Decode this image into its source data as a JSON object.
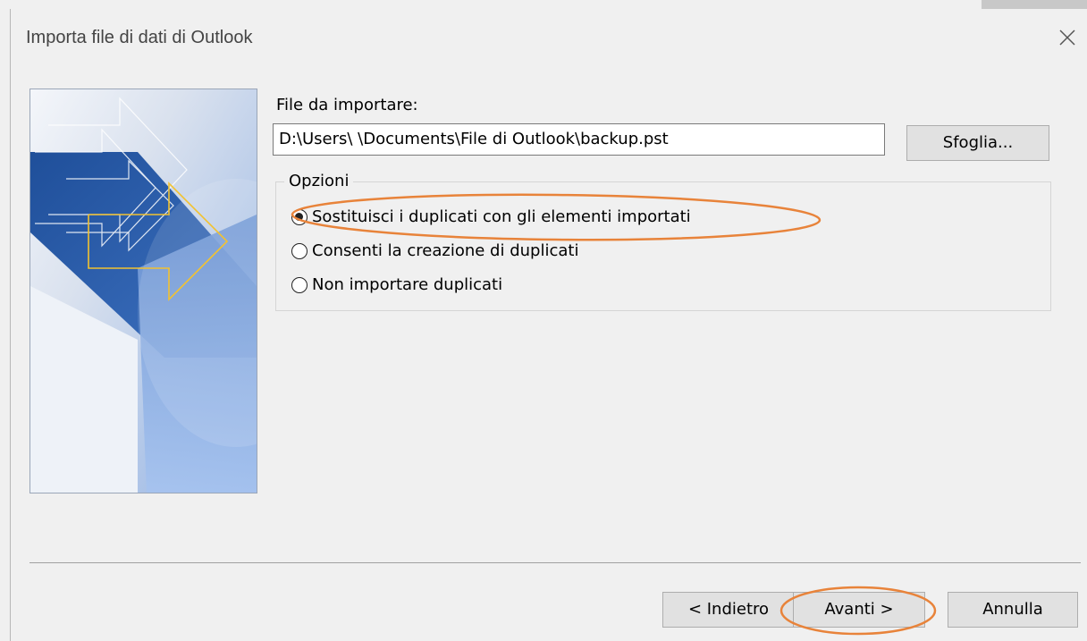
{
  "dialog": {
    "title": "Importa file di dati di Outlook",
    "close_icon": "close-icon"
  },
  "file": {
    "label": "File da importare:",
    "path": "D:\\Users\\        \\Documents\\File di Outlook\\backup.pst",
    "browse_label": "Sfoglia..."
  },
  "options": {
    "legend": "Opzioni",
    "items": [
      {
        "label": "Sostituisci i duplicati con gli elementi importati",
        "checked": true
      },
      {
        "label": "Consenti la creazione di duplicati",
        "checked": false
      },
      {
        "label": "Non importare duplicati",
        "checked": false
      }
    ]
  },
  "buttons": {
    "back": "< Indietro",
    "next": "Avanti >",
    "cancel": "Annulla"
  },
  "colors": {
    "annotation": "#e8833a",
    "accent_arrow": "#f2c230",
    "graphic_blue": "#2f5ea8"
  }
}
